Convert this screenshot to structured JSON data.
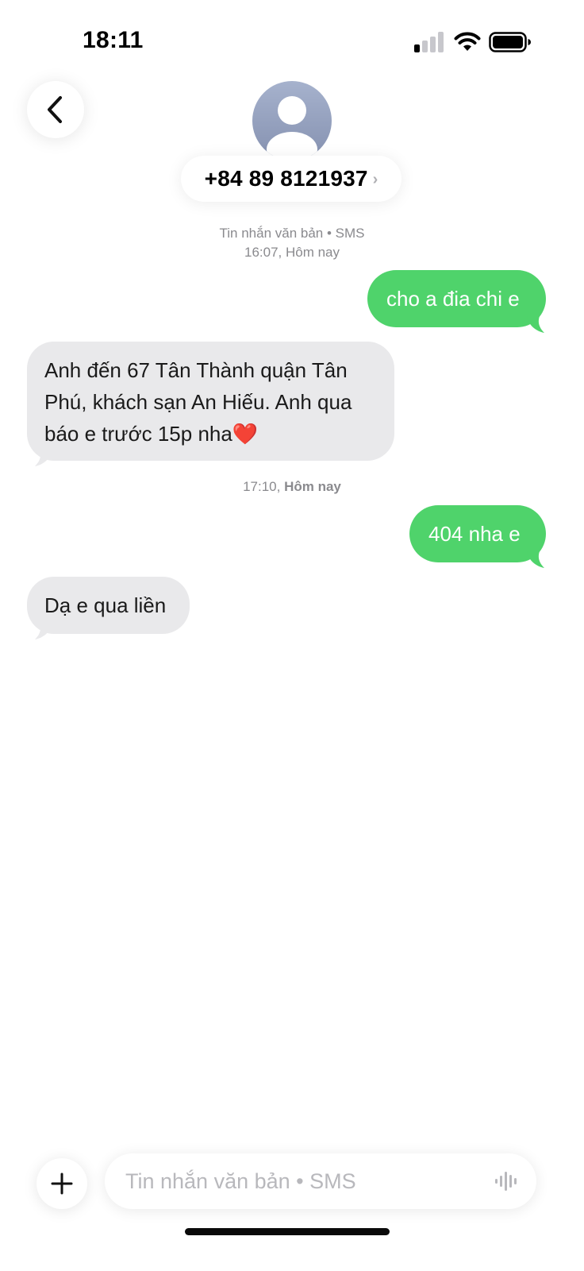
{
  "status_bar": {
    "time": "18:11",
    "icons": [
      "signal-icon",
      "wifi-icon",
      "battery-icon"
    ]
  },
  "header": {
    "back_icon": "chevron-left-icon",
    "avatar_icon": "person-icon",
    "contact_name": "+84 89 8121937",
    "contact_chevron": "›"
  },
  "conversation": {
    "header_meta": {
      "line1": "Tin nhắn văn bản • SMS",
      "line2_time": "16:07,",
      "line2_day": "Hôm nay"
    },
    "messages": [
      {
        "direction": "sent",
        "text": "cho a đia chi e"
      },
      {
        "direction": "received",
        "text": "Anh đến 67 Tân Thành quận Tân Phú, khách sạn An Hiếu. Anh qua báo e trước 15p nha❤️"
      },
      {
        "direction": "sent",
        "text": "404 nha e"
      },
      {
        "direction": "received",
        "text": "Dạ e qua liền"
      }
    ],
    "divider_meta": {
      "time": "17:10,",
      "day": "Hôm nay"
    }
  },
  "composer": {
    "add_icon": "plus-icon",
    "placeholder": "Tin nhắn văn bản • SMS",
    "voice_icon": "waveform-icon"
  },
  "colors": {
    "sent_bubble": "#4fd36b",
    "received_bubble": "#e9e9eb",
    "meta_text": "#8a8a8e"
  }
}
